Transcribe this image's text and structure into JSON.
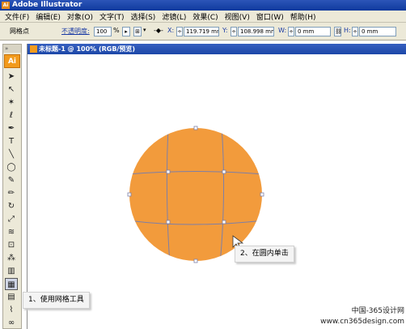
{
  "window": {
    "title": "Adobe Illustrator",
    "app_icon": "Ai"
  },
  "menu": [
    "文件(F)",
    "编辑(E)",
    "对象(O)",
    "文字(T)",
    "选择(S)",
    "滤镜(L)",
    "效果(C)",
    "视图(V)",
    "窗口(W)",
    "帮助(H)"
  ],
  "control_bar": {
    "object_type": "网格点",
    "opacity_label": "不透明度:",
    "opacity_value": "100",
    "opacity_unit": "%",
    "x_label": "X:",
    "x_value": "119.719 mm",
    "y_label": "Y:",
    "y_value": "108.998 mm",
    "w_label": "W:",
    "w_value": "0 mm",
    "h_label": "H:",
    "h_value": "0 mm"
  },
  "toolbox": {
    "badge": "Ai",
    "tools": [
      {
        "name": "selection-tool",
        "glyph": "➤"
      },
      {
        "name": "direct-selection-tool",
        "glyph": "↖"
      },
      {
        "name": "magic-wand-tool",
        "glyph": "✶"
      },
      {
        "name": "lasso-tool",
        "glyph": "ℓ"
      },
      {
        "name": "pen-tool",
        "glyph": "✒"
      },
      {
        "name": "type-tool",
        "glyph": "T"
      },
      {
        "name": "line-tool",
        "glyph": "╲"
      },
      {
        "name": "ellipse-tool",
        "glyph": "◯"
      },
      {
        "name": "paintbrush-tool",
        "glyph": "✎"
      },
      {
        "name": "pencil-tool",
        "glyph": "✏"
      },
      {
        "name": "rotate-tool",
        "glyph": "↻"
      },
      {
        "name": "scale-tool",
        "glyph": "⤢"
      },
      {
        "name": "warp-tool",
        "glyph": "≋"
      },
      {
        "name": "free-transform-tool",
        "glyph": "⊡"
      },
      {
        "name": "symbol-sprayer-tool",
        "glyph": "⁂"
      },
      {
        "name": "graph-tool",
        "glyph": "▥"
      },
      {
        "name": "mesh-tool",
        "glyph": "▦"
      },
      {
        "name": "gradient-tool",
        "glyph": "▤"
      },
      {
        "name": "eyedropper-tool",
        "glyph": "⌇"
      },
      {
        "name": "blend-tool",
        "glyph": "∞"
      }
    ],
    "selected_tool": "mesh-tool"
  },
  "document": {
    "tab_title": "未标题-1 @ 100% (RGB/预览)",
    "fill_color": "#F29B3C",
    "mesh_color": "#7d7fa8"
  },
  "callouts": {
    "step1": "1、使用网格工具",
    "step2": "2、在圆内单击"
  },
  "watermark": {
    "line1": "中国-365设计网",
    "line2": "www.cn365design.com"
  }
}
